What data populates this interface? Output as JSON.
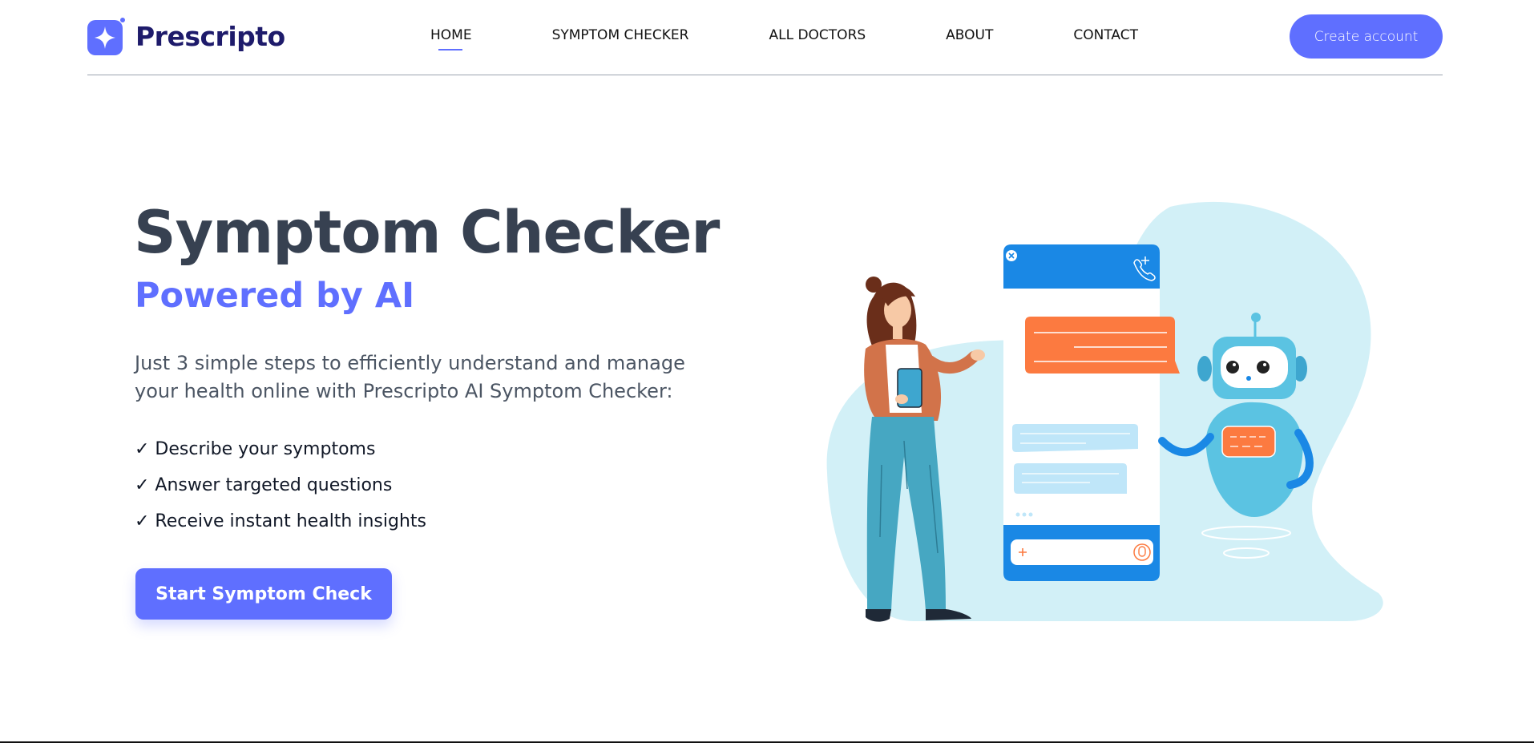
{
  "brand": {
    "name": "Prescripto",
    "accent_color": "#5f6fff",
    "logo_icon": "sparkle-badge-icon"
  },
  "nav": {
    "items": [
      {
        "label": "HOME",
        "active": true
      },
      {
        "label": "SYMPTOM CHECKER",
        "active": false
      },
      {
        "label": "ALL DOCTORS",
        "active": false
      },
      {
        "label": "ABOUT",
        "active": false
      },
      {
        "label": "CONTACT",
        "active": false
      }
    ],
    "create_account_label": "Create account"
  },
  "hero": {
    "title": "Symptom Checker",
    "subtitle": "Powered by AI",
    "description": "Just 3 simple steps to efficiently understand and manage your health online with Prescripto AI Symptom Checker:",
    "steps": [
      "✓ Describe your symptoms",
      "✓ Answer targeted questions",
      "✓ Receive instant health insights"
    ],
    "cta_label": "Start Symptom Check"
  },
  "illustration": {
    "icons": [
      "woman-with-tablet-icon",
      "chat-phone-icon",
      "robot-icon"
    ],
    "colors": {
      "blob": "#d2f0f7",
      "phone_header": "#1a88e5",
      "orange_bubble": "#fc7a40",
      "blue_bubble": "#bfe6f9",
      "robot": "#5bc3e2"
    }
  }
}
